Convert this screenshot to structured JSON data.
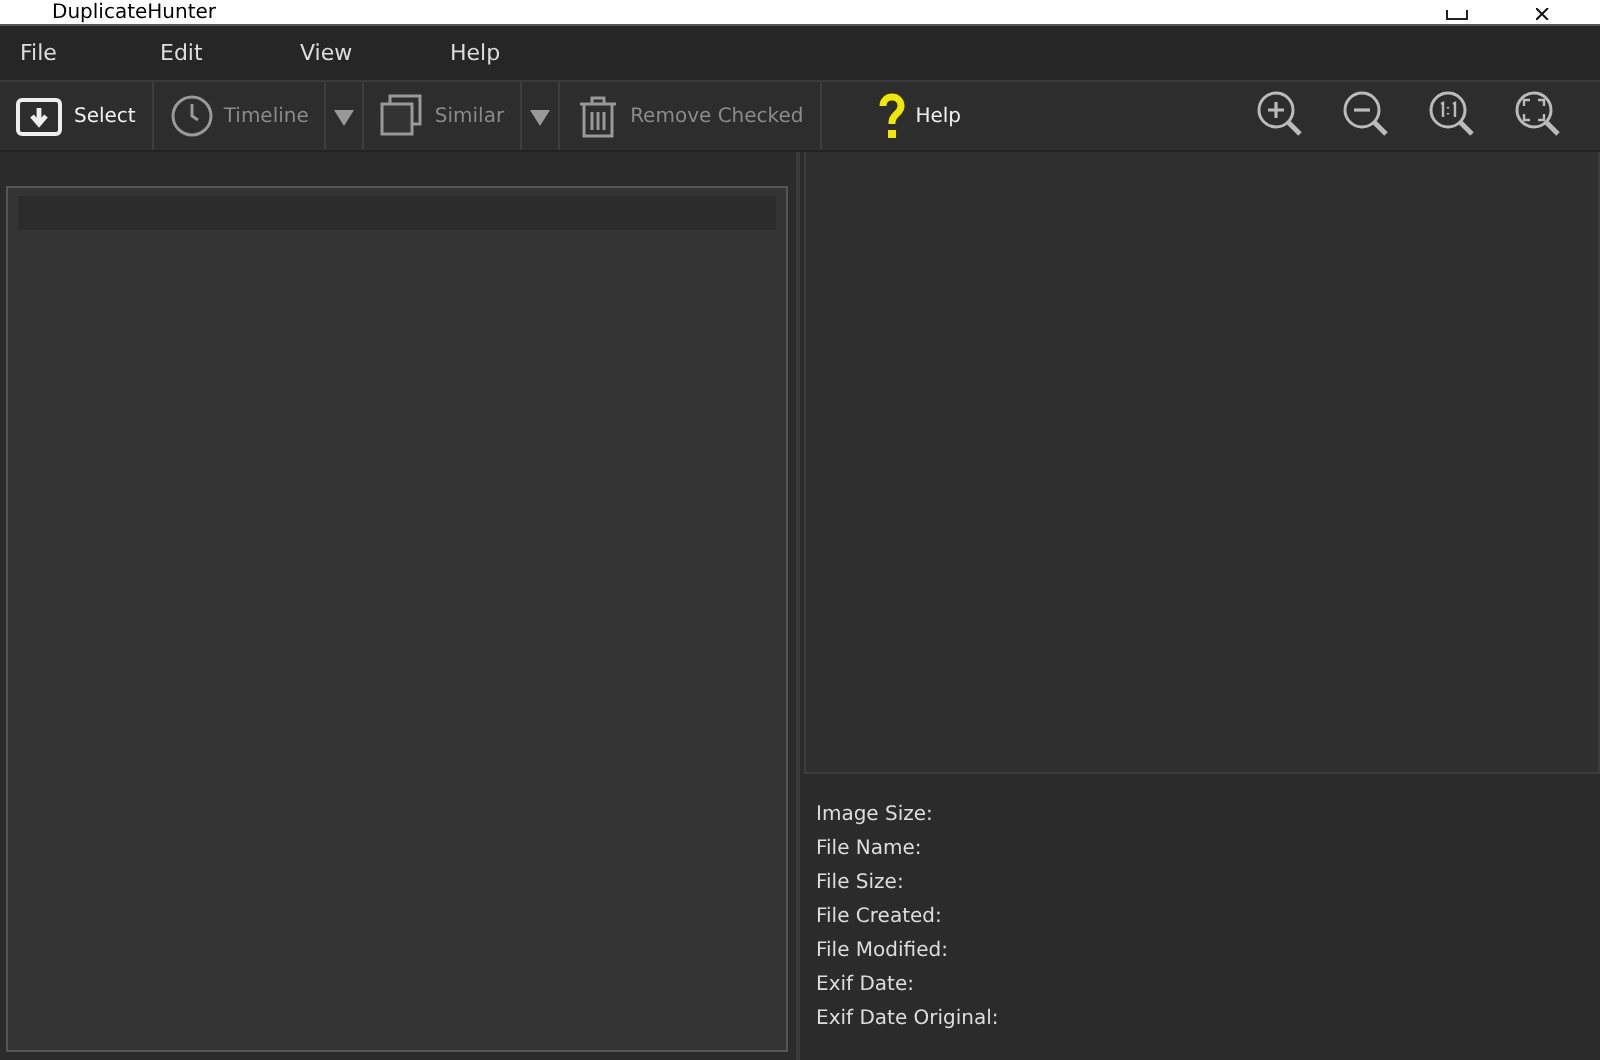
{
  "window": {
    "title": "DuplicateHunter"
  },
  "menu": [
    "File",
    "Edit",
    "View",
    "Help"
  ],
  "toolbar": [
    {
      "kind": "select",
      "label": "Select",
      "disabled": false
    },
    {
      "kind": "timeline",
      "label": "Timeline",
      "disabled": true
    },
    {
      "kind": "dropdown",
      "disabled": true
    },
    {
      "kind": "similar",
      "label": "Similar",
      "disabled": true
    },
    {
      "kind": "dropdown",
      "disabled": true
    },
    {
      "kind": "trash",
      "label": "Remove Checked",
      "disabled": true
    },
    {
      "kind": "help",
      "label": "Help",
      "disabled": false
    }
  ],
  "zoom_tools": [
    {
      "kind": "zoom-in"
    },
    {
      "kind": "zoom-out"
    },
    {
      "kind": "actual-size"
    },
    {
      "kind": "fit"
    }
  ],
  "info_fields": [
    "Image Size:",
    "File Name:",
    "File Size:",
    "File Created:",
    "File Modified:",
    "Exif Date:",
    "Exif Date Original:"
  ]
}
